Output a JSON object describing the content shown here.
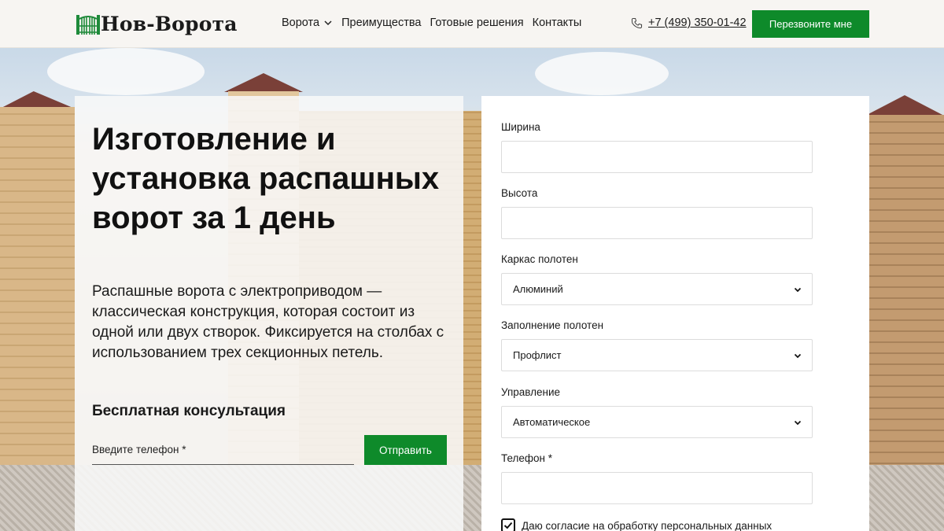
{
  "header": {
    "logo_text": "Нов-Ворота",
    "nav": [
      {
        "label": "Ворота",
        "has_dropdown": true
      },
      {
        "label": "Преимущества"
      },
      {
        "label": "Готовые решения"
      },
      {
        "label": "Контакты"
      }
    ],
    "phone": "+7 (499) 350-01-42",
    "callback_label": "Перезвоните мне"
  },
  "hero": {
    "title": "Изготовление и установка распашных ворот за 1 день",
    "description": "Распашные ворота с электроприводом — классическая конструкция, которая состоит из одной или двух створок. Фиксируется на столбах с использованием трех секционных петель.",
    "consult_title": "Бесплатная консультация",
    "phone_placeholder": "Введите телефон *",
    "send_label": "Отправить"
  },
  "form": {
    "width_label": "Ширина",
    "height_label": "Высота",
    "frame_label": "Каркас полотен",
    "frame_value": "Алюминий",
    "fill_label": "Заполнение полотен",
    "fill_value": "Профлист",
    "control_label": "Управление",
    "control_value": "Автоматическое",
    "phone_label": "Телефон *",
    "consent_label": "Даю согласие на обработку персональных данных",
    "consent_checked": true
  },
  "colors": {
    "accent": "#0e8a2a",
    "header_bg": "#f7f5f2"
  }
}
